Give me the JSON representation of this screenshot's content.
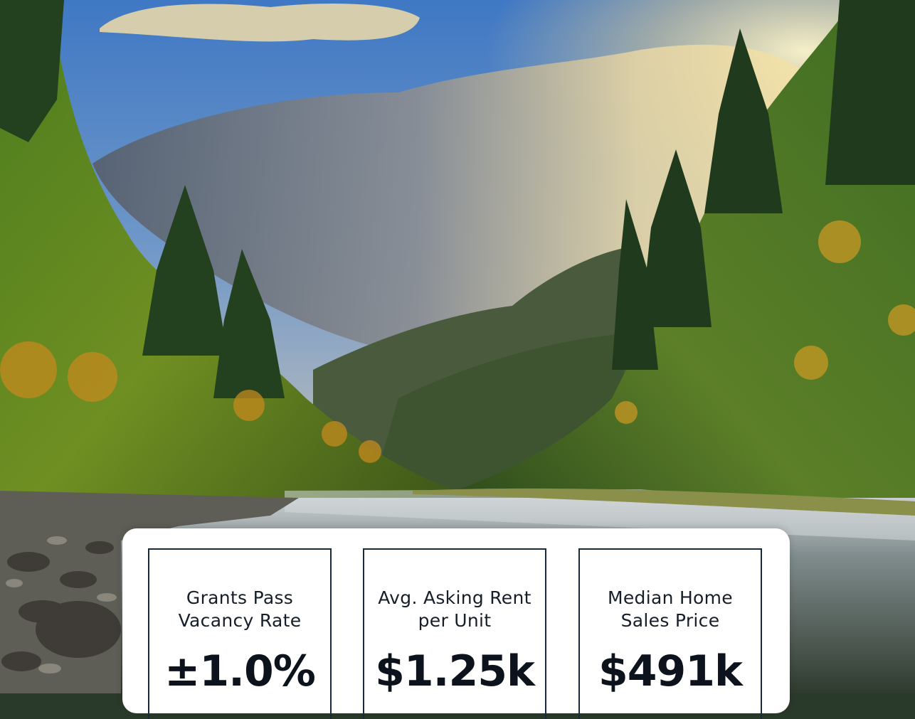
{
  "hero": {
    "image": "mountain river canyon with fog and forest"
  },
  "stats": [
    {
      "label": "Grants Pass\nVacancy Rate",
      "value": "±1.0%"
    },
    {
      "label": "Avg. Asking Rent\nper Unit",
      "value": "$1.25k"
    },
    {
      "label": "Median Home\nSales Price",
      "value": "$491k"
    }
  ],
  "colors": {
    "card_border": "#1b2a3a",
    "text": "#0f1723",
    "panel": "#ffffff"
  }
}
